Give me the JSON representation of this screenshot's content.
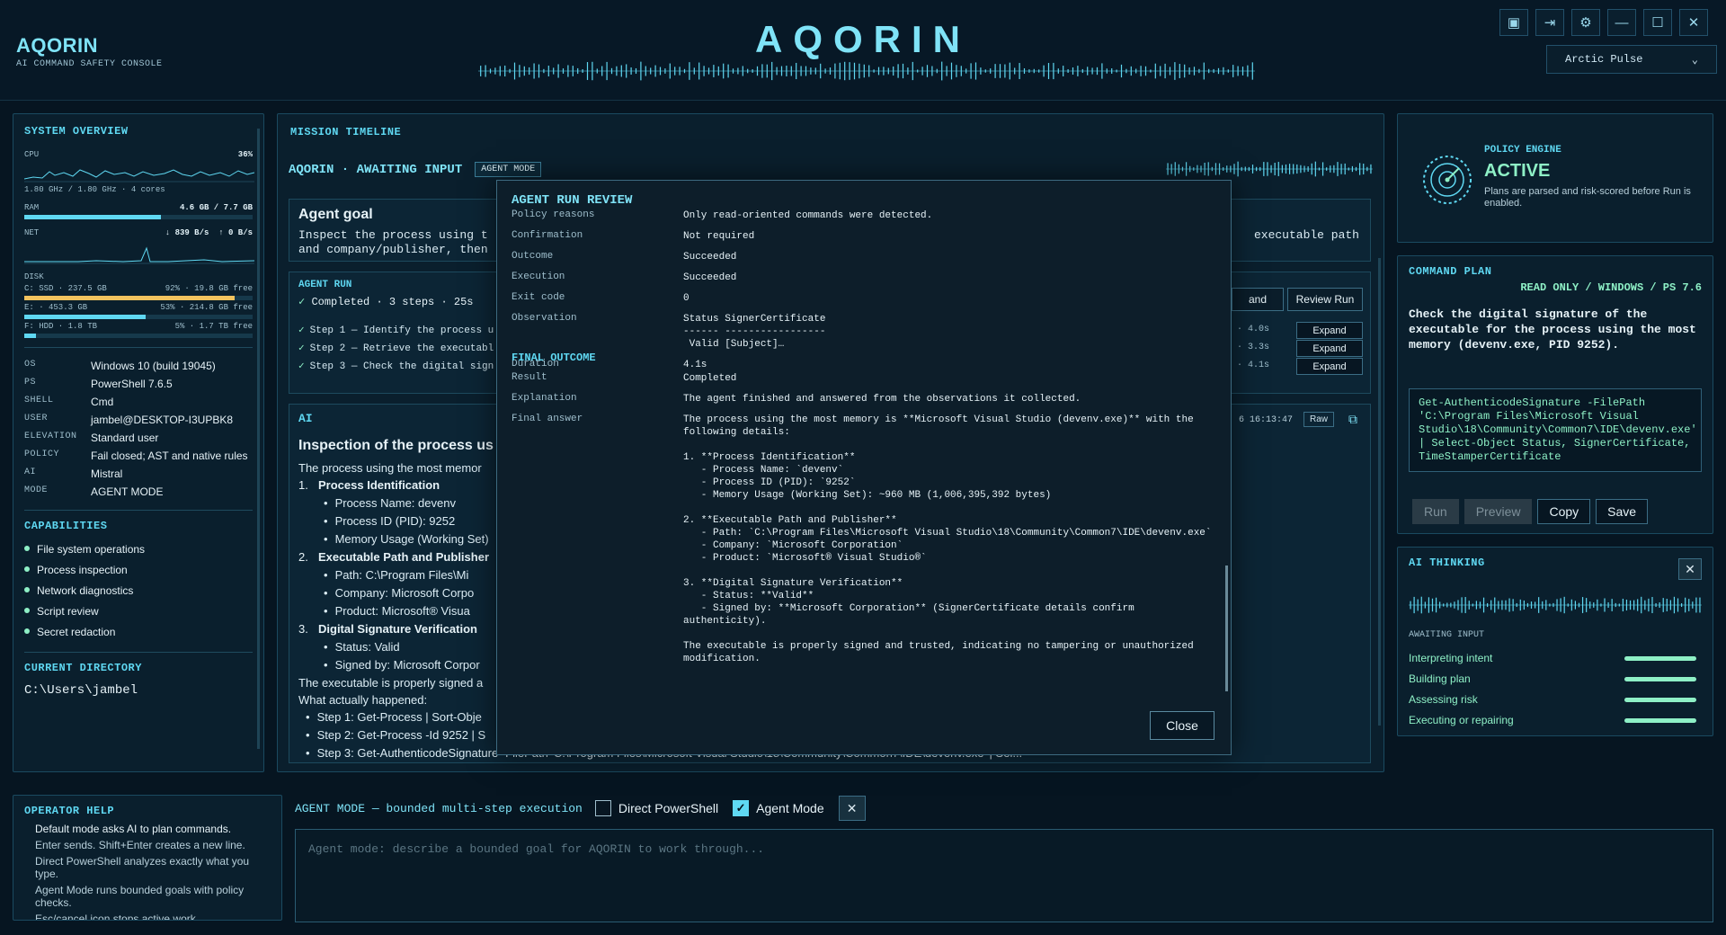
{
  "brand": {
    "name": "AQORIN",
    "subtitle": "AI COMMAND SAFETY CONSOLE"
  },
  "header": {
    "title": "AQORIN",
    "theme": "Arctic Pulse",
    "icons": [
      "panel-icon",
      "login-icon",
      "settings-icon",
      "minimize-icon",
      "maximize-icon",
      "close-icon"
    ]
  },
  "system": {
    "title": "SYSTEM OVERVIEW",
    "cpu": {
      "label": "CPU",
      "value": "36%",
      "detail": "1.80 GHz / 1.80 GHz · 4 cores"
    },
    "ram": {
      "label": "RAM",
      "value": "4.6 GB / 7.7 GB",
      "fraction": 0.6
    },
    "net": {
      "label": "NET",
      "down": "↓ 839 B/s",
      "up": "↑ 0 B/s"
    },
    "disk": {
      "label": "DISK",
      "drives": [
        {
          "name": "C: SSD · 237.5 GB",
          "detail": "92% · 19.8 GB free",
          "fraction": 0.92,
          "color": "#f2c35e"
        },
        {
          "name": "E: · 453.3 GB",
          "detail": "53% · 214.8 GB free",
          "fraction": 0.53,
          "color": "#5fd8f2"
        },
        {
          "name": "F: HDD · 1.8 TB",
          "detail": "5% · 1.7 TB free",
          "fraction": 0.05,
          "color": "#5fd8f2"
        }
      ]
    },
    "info": [
      {
        "k": "OS",
        "v": "Windows 10 (build 19045)"
      },
      {
        "k": "PS",
        "v": "PowerShell 7.6.5"
      },
      {
        "k": "SHELL",
        "v": "Cmd"
      },
      {
        "k": "USER",
        "v": "jambel@DESKTOP-I3UPBK8"
      },
      {
        "k": "ELEVATION",
        "v": "Standard user"
      },
      {
        "k": "POLICY",
        "v": "Fail closed; AST and native rules"
      },
      {
        "k": "AI",
        "v": "Mistral"
      },
      {
        "k": "MODE",
        "v": "AGENT MODE"
      }
    ],
    "capabilities_title": "CAPABILITIES",
    "capabilities": [
      "File system operations",
      "Process inspection",
      "Network diagnostics",
      "Script review",
      "Secret redaction"
    ],
    "dir_title": "CURRENT DIRECTORY",
    "dir": "C:\\Users\\jambel"
  },
  "timeline": {
    "title": "MISSION TIMELINE",
    "status": "AQORIN · AWAITING INPUT",
    "mode_chip": "AGENT MODE",
    "goal": {
      "heading": "Agent goal",
      "text_left": "Inspect the process using t",
      "text_right": "executable path",
      "text_line2": "and company/publisher, then"
    },
    "agent_run": {
      "heading": "AGENT RUN",
      "summary": "Completed · 3 steps · 25s",
      "btn_expand": "and",
      "btn_review": "Review Run",
      "steps": [
        {
          "text": "Step 1 — Identify the process u",
          "meta": "nly · 4.0s",
          "btn": "Expand"
        },
        {
          "text": "Step 2 — Retrieve the executabl",
          "meta": "nly · 3.3s",
          "btn": "Expand"
        },
        {
          "text": "Step 3 — Check the digital sign",
          "meta": "nly · 4.1s",
          "btn": "Expand"
        }
      ]
    },
    "ai": {
      "label": "AI",
      "timestamp": "6 16:13:47",
      "raw": "Raw",
      "heading": "Inspection of the process us",
      "intro": "The process using the most memor",
      "sections": [
        {
          "num": "1.",
          "title": "Process Identification",
          "items": [
            "Process Name: devenv",
            "Process ID (PID): 9252",
            "Memory Usage (Working Set)"
          ]
        },
        {
          "num": "2.",
          "title": "Executable Path and Publisher",
          "items": [
            "Path: C:\\Program Files\\Mi",
            "Company: Microsoft Corpo",
            "Product: Microsoft® Visua"
          ]
        },
        {
          "num": "3.",
          "title": "Digital Signature Verification",
          "items": [
            "Status: Valid",
            "Signed by: Microsoft Corpor"
          ]
        }
      ],
      "conclusion": "The executable is properly signed a",
      "what_happened": "What actually happened:",
      "steps": [
        "Step 1: Get-Process | Sort-Obje",
        "Step 2: Get-Process -Id 9252 | S",
        "Step 3: Get-AuthenticodeSignature -FilePath 'C:\\Program Files\\Microsoft Visual Studio\\18\\Community\\Common7\\IDE\\devenv.exe' | Sel..."
      ]
    }
  },
  "policy": {
    "title": "POLICY ENGINE",
    "status": "ACTIVE",
    "desc": "Plans are parsed and risk-scored before Run is enabled."
  },
  "plan": {
    "title": "COMMAND PLAN",
    "tags": "READ ONLY / WINDOWS / PS 7.6",
    "desc": "Check the digital signature of the executable for the process using the most memory (devenv.exe, PID 9252).",
    "code": "Get-AuthenticodeSignature -FilePath 'C:\\Program Files\\Microsoft Visual Studio\\18\\Community\\Common7\\IDE\\devenv.exe' | Select-Object Status, SignerCertificate, TimeStamperCertificate",
    "btn_run": "Run",
    "btn_preview": "Preview",
    "btn_copy": "Copy",
    "btn_save": "Save"
  },
  "thinking": {
    "title": "AI THINKING",
    "state": "AWAITING INPUT",
    "stages": [
      "Interpreting intent",
      "Building plan",
      "Assessing risk",
      "Executing or repairing"
    ]
  },
  "help": {
    "title": "OPERATOR HELP",
    "lines": [
      "Default mode asks AI to plan commands.",
      "Enter sends. Shift+Enter creates a new line.",
      "Direct PowerShell analyzes exactly what you type.",
      "Agent Mode runs bounded goals with policy checks.",
      "Esc/cancel icon stops active work."
    ]
  },
  "modebar": {
    "label": "AGENT MODE — bounded multi-step execution",
    "direct": "Direct PowerShell",
    "agent": "Agent Mode",
    "placeholder": "Agent mode: describe a bounded goal for AQORIN to work through..."
  },
  "modal": {
    "title": "AGENT RUN REVIEW",
    "rows": [
      {
        "k": "Policy reasons",
        "v": "Only read-oriented commands were detected."
      },
      {
        "k": "Confirmation",
        "v": "Not required"
      },
      {
        "k": "Outcome",
        "v": "Succeeded"
      },
      {
        "k": "Execution",
        "v": "Succeeded"
      },
      {
        "k": "Exit code",
        "v": "0"
      },
      {
        "k": "Observation",
        "v": "Status SignerCertificate\n------ -----------------\n Valid [Subject]…"
      },
      {
        "k": "Duration",
        "v": "4.1s"
      }
    ],
    "final_title": "FINAL OUTCOME",
    "final_rows": [
      {
        "k": "Result",
        "v": "Completed"
      },
      {
        "k": "Explanation",
        "v": "The agent finished and answered from the observations it collected."
      },
      {
        "k": "Final answer",
        "v": "The process using the most memory is **Microsoft Visual Studio (devenv.exe)** with the\nfollowing details:\n\n1. **Process Identification**\n   - Process Name: `devenv`\n   - Process ID (PID): `9252`\n   - Memory Usage (Working Set): ~960 MB (1,006,395,392 bytes)\n\n2. **Executable Path and Publisher**\n   - Path: `C:\\Program Files\\Microsoft Visual Studio\\18\\Community\\Common7\\IDE\\devenv.exe`\n   - Company: `Microsoft Corporation`\n   - Product: `Microsoft® Visual Studio®`\n\n3. **Digital Signature Verification**\n   - Status: **Valid**\n   - Signed by: **Microsoft Corporation** (SignerCertificate details confirm\nauthenticity).\n\nThe executable is properly signed and trusted, indicating no tampering or unauthorized\nmodification."
      }
    ],
    "close": "Close"
  },
  "colors": {
    "accent": "#5fd8f2",
    "ok": "#8ef0c6",
    "warn": "#f2c35e",
    "bg": "#061521"
  }
}
